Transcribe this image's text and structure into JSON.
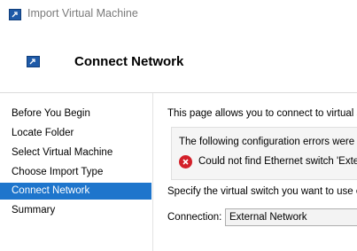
{
  "window": {
    "title": "Import Virtual Machine"
  },
  "header": {
    "title": "Connect Network"
  },
  "nav": {
    "items": [
      {
        "label": "Before You Begin"
      },
      {
        "label": "Locate Folder"
      },
      {
        "label": "Select Virtual Machine"
      },
      {
        "label": "Choose Import Type"
      },
      {
        "label": "Connect Network"
      },
      {
        "label": "Summary"
      }
    ],
    "active_index": 4
  },
  "main": {
    "intro": "This page allows you to connect to virtual sw",
    "error_box": {
      "heading": "The following configuration errors were fo",
      "icon": "error-icon",
      "message": "Could not find Ethernet switch 'Extern"
    },
    "specify_text": "Specify the virtual switch you want to use or",
    "connection": {
      "label": "Connection:",
      "value": "External Network"
    }
  },
  "colors": {
    "accent": "#1e75cc",
    "error": "#d3202a"
  }
}
